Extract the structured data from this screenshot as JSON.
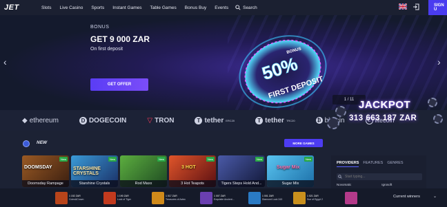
{
  "brand": {
    "logo": "JET",
    "accent": "#4a3cf0"
  },
  "nav": {
    "links": [
      "Slots",
      "Live Casino",
      "Sports",
      "Instant Games",
      "Table Games",
      "Bonus Buy",
      "Events"
    ],
    "search_label": "Search",
    "signup_label": "SIGN U"
  },
  "hero": {
    "label": "BONUS",
    "title": "GET 9 000 ZAR",
    "subtitle": "On first deposit",
    "button": "GET OFFER",
    "counter": "1 / 11",
    "badge_top": "BONUS",
    "badge_percent": "50%",
    "badge_text": "FIRST DEPOSIT"
  },
  "crypto": [
    "ethereum",
    "DOGECOIN",
    "TRON",
    "tether",
    "tether",
    "bitcoin",
    "litecoin"
  ],
  "crypto_sups": [
    "",
    "",
    "",
    "ERC20",
    "TRC20",
    "",
    ""
  ],
  "jackpot": {
    "title": "JACKPOT",
    "amount": "313 663 187 ZAR"
  },
  "new_section": {
    "label": "NEW",
    "more_button": "MORE GAMES"
  },
  "games": [
    {
      "name": "Doomsday Rampage",
      "art": "DOOMSDAY",
      "tag": "New",
      "color": "#6b3a1a"
    },
    {
      "name": "Starshine Crystals",
      "art": "STARSHINE CRYSTALS",
      "tag": "New",
      "color": "#1d4f7a"
    },
    {
      "name": "Rod Maxx",
      "art": "",
      "tag": "New",
      "color": "#2d6a2a"
    },
    {
      "name": "3 Hot Teapots",
      "art": "3 HOT",
      "tag": "New",
      "color": "#8a1c1c"
    },
    {
      "name": "Tigers Steps Hold And...",
      "art": "",
      "tag": "New",
      "color": "#2a3158"
    },
    {
      "name": "Sugar Mix",
      "art": "Sugar Mix",
      "tag": "New",
      "color": "#1f7fb8"
    }
  ],
  "providers": {
    "tabs": [
      "PROVIDERS",
      "FEATURES",
      "GENRES"
    ],
    "search_placeholder": "Start typing...",
    "names": [
      "Novomatic",
      "Igrosoft"
    ]
  },
  "winners": [
    {
      "amount": "1 152 ZAR",
      "game": "Coins&Crown",
      "color": "#b8441a"
    },
    {
      "amount": "1 190 ZAR",
      "game": "Lock of Tiger",
      "color": "#c23a1e"
    },
    {
      "amount": "1 017 ZAR",
      "game": "Treasures of Aztec",
      "color": "#d08a1a"
    },
    {
      "amount": "1 007 ZAR",
      "game": "Exquisite Ancient...",
      "color": "#6a3fb0"
    },
    {
      "amount": "1 001 ZAR",
      "game": "Diamond Luck 243",
      "color": "#2a7ac4"
    },
    {
      "amount": "1 021 ZAR",
      "game": "Sun of Egypt 2",
      "color": "#c9901d"
    },
    {
      "amount": "",
      "game": "",
      "color": "#b43a8a"
    }
  ],
  "current_winners_label": "Current winners"
}
